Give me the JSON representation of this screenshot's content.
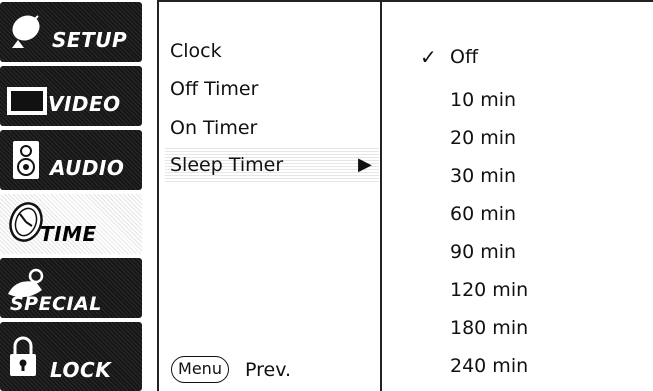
{
  "sidebar": {
    "categories": [
      {
        "label": "SETUP",
        "icon": "satellite-dish-icon"
      },
      {
        "label": "VIDEO",
        "icon": "tv-screen-icon"
      },
      {
        "label": "AUDIO",
        "icon": "speaker-icon"
      },
      {
        "label": "TIME",
        "icon": "clock-icon"
      },
      {
        "label": "SPECIAL",
        "icon": "remote-icon"
      },
      {
        "label": "LOCK",
        "icon": "padlock-icon"
      }
    ],
    "active": "TIME"
  },
  "menu": {
    "items": [
      "Clock",
      "Off Timer",
      "On Timer",
      "Sleep Timer"
    ],
    "selected": "Sleep Timer",
    "submenu_arrow": "▶"
  },
  "options": {
    "checkmark": "✓",
    "checked": "Off",
    "values": [
      "Off",
      "10 min",
      "20 min",
      "30 min",
      "60 min",
      "90 min",
      "120 min",
      "180 min",
      "240 min"
    ]
  },
  "footer": {
    "menu_button": "Menu",
    "prev_label": "Prev."
  }
}
